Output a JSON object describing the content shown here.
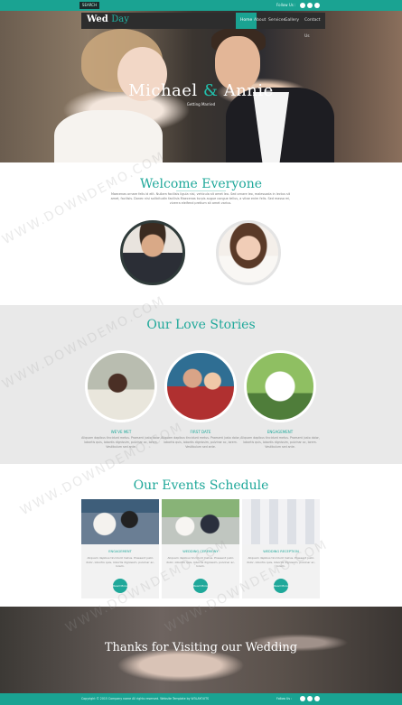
{
  "topbar": {
    "button_label": "SEARCH",
    "follow_label": "Follow Us :"
  },
  "navbar": {
    "logo_part1": "Wed",
    "logo_part2": "Day",
    "items": [
      "Home",
      "About",
      "Services",
      "Gallery",
      "Contact Us"
    ]
  },
  "hero": {
    "title_part1": "Michael",
    "title_amp": "&",
    "title_part2": "Annie",
    "subtitle": "Getting Married"
  },
  "welcome": {
    "title": "Welcome Everyone",
    "text": "Maecenas ornare felis id elit. Nullam facilisis ligula nisi, vehicula sit amet leo. Sed ornare leo, malesuada in lectus sit amet, facilisis. Donec nisi sollicitudin facilisis Maecenas turpis augue congue tellus, a vitae enim felis. Sed massa mi, viverra eleifend pretium sit amet varius."
  },
  "love": {
    "title": "Our Love Stories",
    "stories": [
      {
        "label": "WE'VE MET",
        "text": "Aliquam dapibus tincidunt metus. Praesent justo dolor, lobortis quis, lobortis dignissim, pulvinar ac, lorem. Vestibulum sed ante."
      },
      {
        "label": "FIRST DATE",
        "text": "Aliquam dapibus tincidunt metus. Praesent justo dolor, lobortis quis, lobortis dignissim, pulvinar ac, lorem. Vestibulum sed ante."
      },
      {
        "label": "ENGAGEMENT",
        "text": "Aliquam dapibus tincidunt metus. Praesent justo dolor, lobortis quis, lobortis dignissim, pulvinar ac, lorem. Vestibulum sed ante."
      }
    ]
  },
  "events": {
    "title": "Our Events Schedule",
    "cards": [
      {
        "label": "ENGAGEMENT",
        "text": "Aliquam dapibus tincidunt metus. Praesent justo dolor, lobortis quis, lobortis dignissim, pulvinar ac, lorem.",
        "button": "Read More"
      },
      {
        "label": "WEDDING CEREMONY",
        "text": "Aliquam dapibus tincidunt metus. Praesent justo dolor, lobortis quis, lobortis dignissim, pulvinar ac, lorem.",
        "button": "Read More"
      },
      {
        "label": "WEDDING RECEPTION",
        "text": "Aliquam dapibus tincidunt metus. Praesent justo dolor, lobortis quis, lobortis dignissim, pulvinar ac, lorem.",
        "button": "Read More"
      }
    ]
  },
  "thanks": {
    "title": "Thanks for Visiting our Wedding"
  },
  "footer": {
    "copyright": "Copyright © 2015 Company name All rights reserved. Website Template by W3LAYOUTS",
    "follow_label": "Follow Us :"
  },
  "watermark": "WWW.DOWNDEMO.COM",
  "colors": {
    "accent": "#1fa89a",
    "topbar": "#1aa392",
    "nav": "#2d2d2d"
  }
}
